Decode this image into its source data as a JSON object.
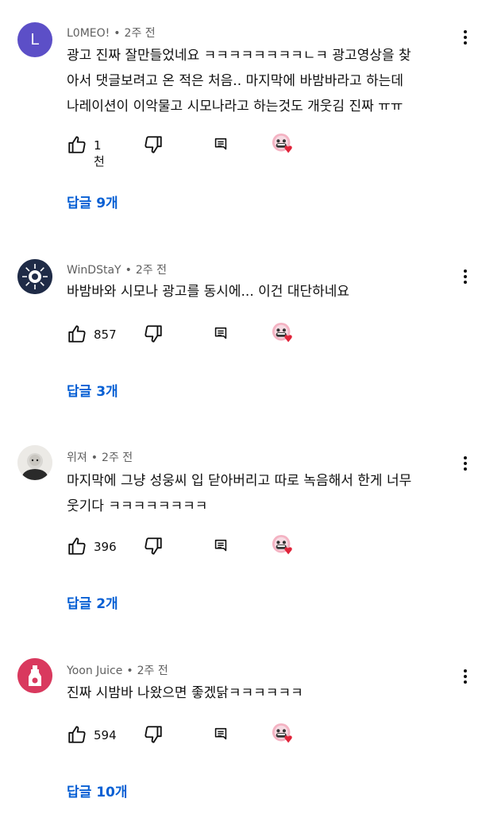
{
  "comments": [
    {
      "author": "L0MEO!",
      "time": "2주 전",
      "avatar_letter": "L",
      "text": "광고 진짜 잘만들었네요 ㅋㅋㅋㅋㅋㅋㅋㅋㄴㅋ 광고영상을 찾\n아서 댓글보려고 온 적은 처음.. 마지막에 바밤바라고 하는데\n나레이션이 이악물고 시모나라고 하는것도 개웃김 진짜 ㅠㅠ",
      "likes": "1천",
      "replies": "답글 9개"
    },
    {
      "author": "WinDStaY",
      "time": "2주 전",
      "text": "바밤바와 시모나 광고를 동시에... 이건 대단하네요",
      "likes": "857",
      "replies": "답글 3개"
    },
    {
      "author": "위져",
      "time": "2주 전",
      "text": "마지막에 그냥 성웅씨 입 닫아버리고 따로 녹음해서 한게 너무\n웃기다 ㅋㅋㅋㅋㅋㅋㅋㅋ",
      "likes": "396",
      "replies": "답글 2개"
    },
    {
      "author": "Yoon Juice",
      "time": "2주 전",
      "text": "진짜 시밤바 나왔으면 좋겠닭ㅋㅋㅋㅋㅋㅋ",
      "likes": "594",
      "replies": "답글 10개"
    }
  ],
  "separator": "•",
  "colors": {
    "link": "#065fd4",
    "meta": "#606060",
    "avatar_purple": "#5c4fc7",
    "heart": "#e0243a",
    "yoon_bg": "#d9395e"
  }
}
